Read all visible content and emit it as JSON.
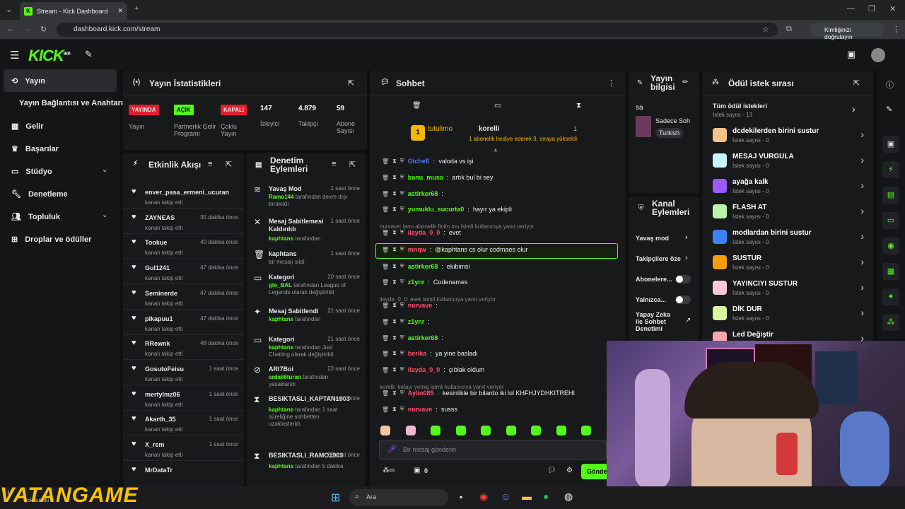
{
  "browser": {
    "tab_title": "Stream - Kick Dashboard",
    "url": "dashboard.kick.com/stream",
    "identity": "Kimliğinizi doğrulayın"
  },
  "brand": {
    "logo": "KICK",
    "beta": "BETA",
    "accent": "#53fc18"
  },
  "sidebar": {
    "items": [
      {
        "label": "Yayın",
        "icon": "stream-icon"
      },
      {
        "label": "Yayın Bağlantısı ve Anahtarı",
        "icon": ""
      },
      {
        "label": "Gelir",
        "icon": "income-icon"
      },
      {
        "label": "Başarılar",
        "icon": "trophy-icon"
      },
      {
        "label": "Stüdyo",
        "icon": "studio-icon"
      },
      {
        "label": "Denetleme",
        "icon": "wrench-icon"
      },
      {
        "label": "Topluluk",
        "icon": "people-icon"
      },
      {
        "label": "Droplar ve ödüller",
        "icon": "drops-icon"
      }
    ]
  },
  "stats": {
    "title": "Yayın İstatistikleri",
    "cells": [
      {
        "value": "YAYINDA",
        "label": "Yayın"
      },
      {
        "value": "AÇIK",
        "label": "Partnerlik Gelir Programı"
      },
      {
        "value": "KAPALI",
        "label": "Çoklu Yayın"
      },
      {
        "value": "147",
        "label": "İzleyici"
      },
      {
        "value": "4.879",
        "label": "Takipçi"
      },
      {
        "value": "59",
        "label": "Abone Sayısı"
      }
    ]
  },
  "activity": {
    "title": "Etkinlik Akışı",
    "items": [
      {
        "name": "enver_pasa_ermeni_ucuran",
        "time": "",
        "desc": "kanalı takip etti"
      },
      {
        "name": "ZAYNEAS",
        "time": "35 dakika önce",
        "desc": "kanalı takip etti"
      },
      {
        "name": "Tookue",
        "time": "40 dakika önce",
        "desc": "kanalı takip etti"
      },
      {
        "name": "Gul1241",
        "time": "47 dakika önce",
        "desc": "kanalı takip etti"
      },
      {
        "name": "Seminerde",
        "time": "47 dakika önce",
        "desc": "kanalı takip etti"
      },
      {
        "name": "pikapuu1",
        "time": "47 dakika önce",
        "desc": "kanalı takip etti"
      },
      {
        "name": "RRewnk",
        "time": "48 dakika önce",
        "desc": "kanalı takip etti"
      },
      {
        "name": "GosutoFeisu",
        "time": "1 saat önce",
        "desc": "kanalı takip etti"
      },
      {
        "name": "mertylmz06",
        "time": "1 saat önce",
        "desc": "kanalı takip etti"
      },
      {
        "name": "Akarth_35",
        "time": "1 saat önce",
        "desc": "kanalı takip etti"
      },
      {
        "name": "X_rem",
        "time": "1 saat önce",
        "desc": "kanalı takip etti"
      },
      {
        "name": "MrDataTr",
        "time": "",
        "desc": ""
      }
    ]
  },
  "moderation": {
    "title": "Denetim Eylemleri",
    "items": [
      {
        "title": "Yavaş Mod",
        "time": "1 saat önce",
        "who": "Ramo144",
        "desc": "tarafından devre dışı bırakıldı"
      },
      {
        "title": "Mesaj Sabitlemesi Kaldırıldı",
        "time": "1 saat önce",
        "who": "kaphtans",
        "desc": "tarafından"
      },
      {
        "title": "kaphtans",
        "time": "1 saat önce",
        "who": "",
        "desc": "bir mesajı sildi"
      },
      {
        "title": "Kategori",
        "time": "20 saat önce",
        "who": "glo_BAL",
        "desc": "tarafından League of Legends olarak değiştirildi"
      },
      {
        "title": "Mesaj Sabitlendi",
        "time": "21 saat önce",
        "who": "kaphtans",
        "desc": "tarafından"
      },
      {
        "title": "Kategori",
        "time": "21 saat önce",
        "who": "kaphtans",
        "desc": "tarafından Just Chatting olarak değiştirildi"
      },
      {
        "title": "ARI7Boi",
        "time": "23 saat önce",
        "who": "arda66turan",
        "desc": "tarafından yasaklandı"
      },
      {
        "title": "BESIKTASLI_KAPTAN1903",
        "time": "23 saat önce",
        "who": "kaphtans",
        "desc": "tarafından 1 saat süreliğine sohbetten uzaklaştırıldı"
      },
      {
        "title": "BESIKTASLI_RAMO1903",
        "time": "23 saat önce",
        "who": "kaphtans",
        "desc": "tarafından 5 dakika"
      }
    ]
  },
  "chat": {
    "title": "Sohbet",
    "pinned_user": "tutulimo",
    "pinned_user2": "korelli",
    "pinned_count": "1",
    "pinned_text": "1 abonelik hediye ederek 3. sıraya yükseldi",
    "placeholder": "Bir mesaj gönderin",
    "send": "Gönder",
    "footer_count": "0",
    "messages": [
      {
        "user": "OicheE",
        "text": "valoda vs işi",
        "color": "#4f7cff"
      },
      {
        "user": "banu_musa",
        "text": "artık bul bi sey",
        "color": "#53fc18"
      },
      {
        "user": "astirker68",
        "text": "",
        "color": "#53fc18"
      },
      {
        "user": "yumuklu_sucurta0",
        "text": "hayır ya ekipli",
        "color": "#53fc18"
      },
      {
        "reply": "nurvave: lann abonelik finito mu isimli kullanıcıya yanıt veriyor"
      },
      {
        "user": "ilayda_0_0",
        "text": "evet",
        "color": "#ff4d6d"
      },
      {
        "user": "mnqw",
        "text": "@kaphtans cs olur codmaes olur",
        "color": "#ff4d6d",
        "highlight": true
      },
      {
        "user": "astirker68",
        "text": "ekibimsi",
        "color": "#53fc18"
      },
      {
        "user": "z1ynr",
        "text": "Codenames",
        "color": "#53fc18"
      },
      {
        "reply": "ilayda_0_0: evet isimli kullanıcıya yanıt veriyor"
      },
      {
        "user": "nurvave",
        "text": "",
        "color": "#ff4d6d"
      },
      {
        "user": "z1ynr",
        "text": "",
        "color": "#53fc18"
      },
      {
        "user": "astirker68",
        "text": "",
        "color": "#53fc18"
      },
      {
        "user": "berika",
        "text": "ya yine basladı",
        "color": "#ff4d6d"
      },
      {
        "user": "ilayda_0_0",
        "text": "çıblak oldum",
        "color": "#ff4d6d"
      },
      {
        "reply": "korelli: kafayı yemiş isimli kullanıcıya yanıt veriyor"
      },
      {
        "user": "Aylin085",
        "text": "kesinlikle bir bilardo iki lol KHFHJYDHKITREHI",
        "color": "#ff4d6d"
      },
      {
        "user": "nurvave",
        "text": "susss",
        "color": "#ff4d6d"
      }
    ]
  },
  "stream_info": {
    "title": "Yayın bilgisi",
    "text": "sa",
    "sub": "Sadece Soh",
    "tag": "Turkish"
  },
  "channel_actions": {
    "title": "Kanal Eylemleri",
    "items": [
      "Yavaş mod",
      "Takipçilere öze",
      "Abonelere...",
      "Yalnızca...",
      "Yapay Zeka ile Sohbet Denetimi"
    ]
  },
  "rewards": {
    "title": "Ödül istek sırası",
    "all": "Tüm ödül istekleri",
    "all_sub": "İstek sayısı - 13",
    "items": [
      {
        "title": "dcdekilerden birini sustur",
        "sub": "İstek sayısı - 0",
        "color": "#f5c28a"
      },
      {
        "title": "MESAJ VURGULA",
        "sub": "İstek sayısı - 0",
        "color": "#c8f4ff"
      },
      {
        "title": "ayağa kalk",
        "sub": "İstek sayısı - 0",
        "color": "#9b59ff"
      },
      {
        "title": "FLASH AT",
        "sub": "İstek sayısı - 0",
        "color": "#b9f5a8"
      },
      {
        "title": "modlardan birini sustur",
        "sub": "İstek sayısı - 0",
        "color": "#3b82f6"
      },
      {
        "title": "SUSTUR",
        "sub": "İstek sayısı - 0",
        "color": "#f59e0b"
      },
      {
        "title": "YAYINCIYI SUSTUR",
        "sub": "İstek sayısı - 0",
        "color": "#fbc8d8"
      },
      {
        "title": "DİK DUR",
        "sub": "İstek sayısı - 0",
        "color": "#d9f99d"
      },
      {
        "title": "Led Değiştir",
        "sub": "",
        "color": "#fda4af"
      }
    ]
  },
  "taskbar": {
    "search": "Ara",
    "weather": "13",
    "weather_sub": "Çok bulutlu"
  },
  "watermark": "VATANGAME"
}
